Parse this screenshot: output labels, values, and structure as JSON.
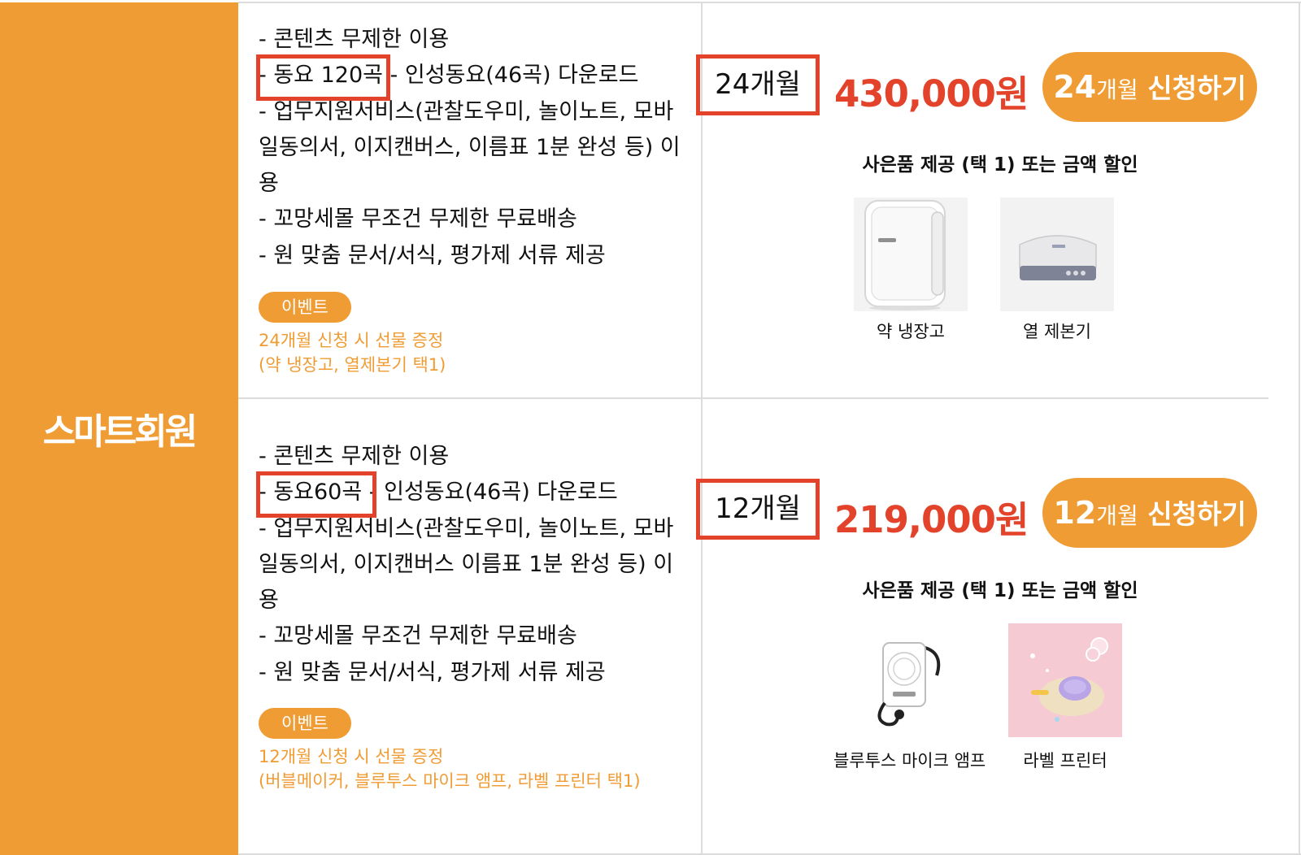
{
  "colors": {
    "accent": "#f09c34",
    "highlight": "#e2432a",
    "price": "#e2432a"
  },
  "side": {
    "title": "스마트회원"
  },
  "plans": [
    {
      "features": [
        "- 콘텐츠 무제한 이용",
        "- 동요 120곡 - 인성동요(46곡) 다운로드",
        "- 업무지원서비스(관찰도우미, 놀이노트, 모바일동의서, 이지캔버스, 이름표 1분 완성 등) 이용",
        "- 꼬망세몰 무조건 무제한 무료배송",
        "- 원 맞춤 문서/서식, 평가제 서류 제공"
      ],
      "event_label": "이벤트",
      "event_line1": "24개월 신청 시 선물 증정",
      "event_line2": "(약 냉장고, 열제본기 택1)",
      "period": "24개월",
      "price": "430,000원",
      "apply_num": "24",
      "apply_label1": "개월",
      "apply_label2": " 신청하기",
      "gift_heading": "사은품 제공 (택 1) 또는 금액 할인",
      "gifts": [
        {
          "name": "약 냉장고",
          "icon": "mini-fridge-icon"
        },
        {
          "name": "열 제본기",
          "icon": "thermal-binder-icon"
        }
      ]
    },
    {
      "features": [
        "- 콘텐츠 무제한 이용",
        "- 동요60곡 - 인성동요(46곡) 다운로드",
        "- 업무지원서비스(관찰도우미, 놀이노트, 모바일동의서, 이지캔버스 이름표 1분 완성 등) 이용",
        "- 꼬망세몰 무조건 무제한 무료배송",
        "- 원 맞춤 문서/서식, 평가제 서류 제공"
      ],
      "event_label": "이벤트",
      "event_line1": "12개월 신청 시 선물 증정",
      "event_line2": "(버블메이커, 블루투스 마이크 앰프, 라벨 프린터 택1)",
      "period": "12개월",
      "price": "219,000원",
      "apply_num": "12",
      "apply_label1": "개월",
      "apply_label2": " 신청하기",
      "gift_heading": "사은품 제공 (택 1) 또는 금액 할인",
      "gifts": [
        {
          "name": "블루투스 마이크 앰프",
          "icon": "bluetooth-mic-amp-icon"
        },
        {
          "name": "라벨 프린터",
          "icon": "label-printer-icon"
        }
      ]
    }
  ]
}
